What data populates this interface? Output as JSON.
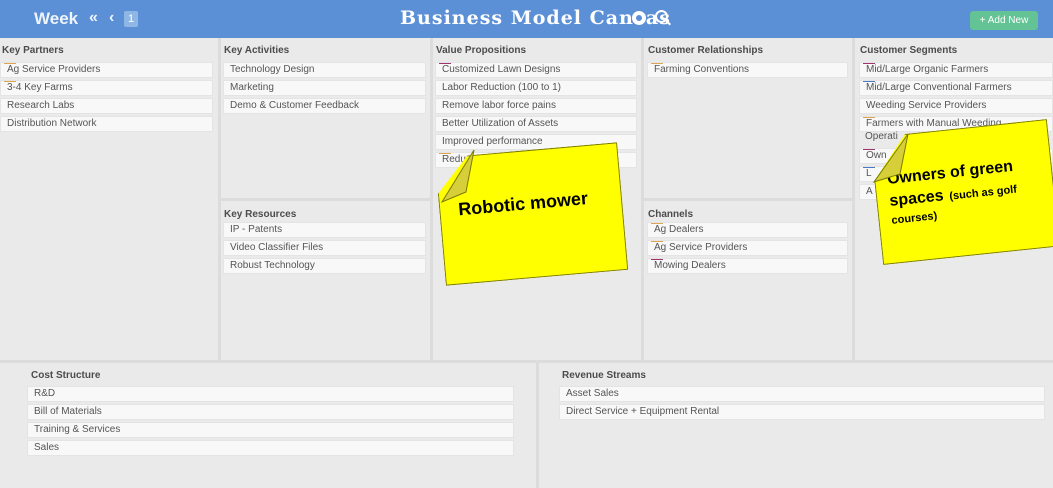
{
  "header": {
    "week_label": "Week",
    "prev_fast": "«",
    "prev": "‹",
    "week_number": "1",
    "title": "Business Model Canvas",
    "add_button": "+ Add New",
    "icons": [
      "settings-icon",
      "search-icon"
    ]
  },
  "colors": {
    "topbar": "#5b8fd6",
    "sticky": "#ffff00",
    "add_button": "#63c394"
  },
  "key_partners": {
    "title": "Key Partners",
    "items": [
      "Ag Service Providers",
      "3-4 Key Farms",
      "Research Labs",
      "Distribution Network"
    ]
  },
  "key_activities": {
    "title": "Key Activities",
    "items": [
      "Technology Design",
      "Marketing",
      "Demo & Customer Feedback"
    ]
  },
  "key_resources": {
    "title": "Key Resources",
    "items": [
      "IP - Patents",
      "Video Classifier Files",
      "Robust Technology"
    ]
  },
  "value_propositions": {
    "title": "Value Propositions",
    "items": [
      "Customized Lawn Designs",
      "Labor Reduction (100 to 1)",
      "Remove labor force pains",
      "Better Utilization of Assets",
      "Improved performance",
      "Reduced"
    ]
  },
  "customer_relationships": {
    "title": "Customer Relationships",
    "items": [
      "Farming Conventions"
    ]
  },
  "channels": {
    "title": "Channels",
    "items": [
      "Ag Dealers",
      "Ag Service Providers",
      "Mowing Dealers"
    ]
  },
  "customer_segments": {
    "title": "Customer Segments",
    "items": [
      "Mid/Large Organic Farmers",
      "Mid/Large Conventional Farmers",
      "Weeding Service Providers",
      "Farmers with Manual Weeding",
      "Operati",
      "Own",
      "L",
      "A"
    ]
  },
  "cost_structure": {
    "title": "Cost Structure",
    "items": [
      "R&D",
      "Bill of Materials",
      "Training & Services",
      "Sales"
    ]
  },
  "revenue_streams": {
    "title": "Revenue Streams",
    "items": [
      "Asset Sales",
      "Direct Service + Equipment Rental"
    ]
  },
  "sticky_notes": {
    "robotic_mower": "Robotic mower",
    "green_spaces_main_1": "Owners of green",
    "green_spaces_main_2": "spaces",
    "green_spaces_sub_1": "(such as golf",
    "green_spaces_sub_2": "courses)"
  }
}
